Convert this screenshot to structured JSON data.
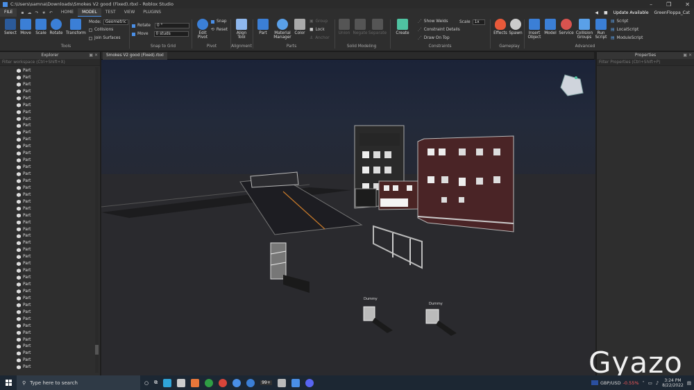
{
  "window": {
    "title": "C:\\Users\\samna\\Downloads\\Smokes V2 good (Fixed).rbxl - Roblox Studio",
    "controls": [
      "–",
      "❐",
      "✕"
    ]
  },
  "menu": {
    "file": "FILE",
    "tabs": [
      "HOME",
      "MODEL",
      "TEST",
      "VIEW",
      "PLUGINS"
    ],
    "active_tab": "MODEL",
    "update": "Update Available",
    "user": "GreenFloppa_Cat"
  },
  "ribbon": {
    "tools": {
      "select": "Select",
      "move": "Move",
      "scale": "Scale",
      "rotate": "Rotate",
      "transform": "Transform",
      "group": "Tools"
    },
    "mode_label": "Mode:",
    "mode_value": "Geometric",
    "collisions": "Collisions",
    "join_surfaces": "Join Surfaces",
    "snap": {
      "rotate_label": "Rotate",
      "rotate_value": "0 °",
      "move_label": "Move",
      "move_value": "0 studs",
      "group": "Snap to Grid"
    },
    "pivot": {
      "edit": "Edit Pivot",
      "snap": "Snap",
      "reset": "Reset",
      "group": "Pivot"
    },
    "alignment": {
      "align": "Align Tool",
      "group": "Alignment"
    },
    "parts": {
      "part": "Part",
      "material": "Material Manager",
      "color": "Color",
      "group_btn": "Group",
      "lock": "Lock",
      "anchor": "Anchor",
      "group": "Parts"
    },
    "solid": {
      "union": "Union",
      "negate": "Negate",
      "separate": "Separate",
      "group": "Solid Modeling"
    },
    "constraints": {
      "create": "Create",
      "show_welds": "Show Welds",
      "constraint_details": "Constraint Details",
      "draw_on_top": "Draw On Top",
      "scale_label": "Scale",
      "scale_value": "1x",
      "group": "Constraints"
    },
    "gameplay": {
      "effects": "Effects",
      "spawn": "Spawn",
      "group": "Gameplay"
    },
    "advanced": {
      "insert_object": "Insert Object",
      "model": "Model",
      "service": "Service",
      "collision_groups": "Collision Groups",
      "run_script": "Run Script",
      "script": "Script",
      "local_script": "LocalScript",
      "module_script": "ModuleScript",
      "group": "Advanced"
    }
  },
  "explorer": {
    "title": "Explorer",
    "filter_placeholder": "Filter workspace (Ctrl+Shift+X)",
    "items": [
      "Part",
      "Part",
      "Part",
      "Part",
      "Part",
      "Part",
      "Part",
      "Part",
      "Part",
      "Part",
      "Part",
      "Part",
      "Part",
      "Part",
      "Part",
      "Part",
      "Part",
      "Part",
      "Part",
      "Part",
      "Part",
      "Part",
      "Part",
      "Part",
      "Part",
      "Part",
      "Part",
      "Part",
      "Part",
      "Part",
      "Part",
      "Part",
      "Part",
      "Part",
      "Part",
      "Part",
      "Part",
      "Part",
      "Part",
      "Part",
      "Part",
      "Part",
      "Part",
      "Part"
    ]
  },
  "properties": {
    "title": "Properties",
    "filter_placeholder": "Filter Properties (Ctrl+Shift+P)"
  },
  "document_tab": "Smokes V2 good (Fixed).rbxl",
  "viewport": {
    "dummy_labels": [
      "Dummy",
      "Dummy"
    ]
  },
  "watermark": "Gyazo",
  "taskbar": {
    "search_placeholder": "Type here to search",
    "badge": "99+",
    "fx_label": "GBP/USD",
    "fx_change": "-0.55%",
    "time": "3:24 PM",
    "date": "8/22/2022",
    "colors": {
      "fx_negative": "#ff5c5c",
      "accent": "#4a8fe7"
    }
  }
}
